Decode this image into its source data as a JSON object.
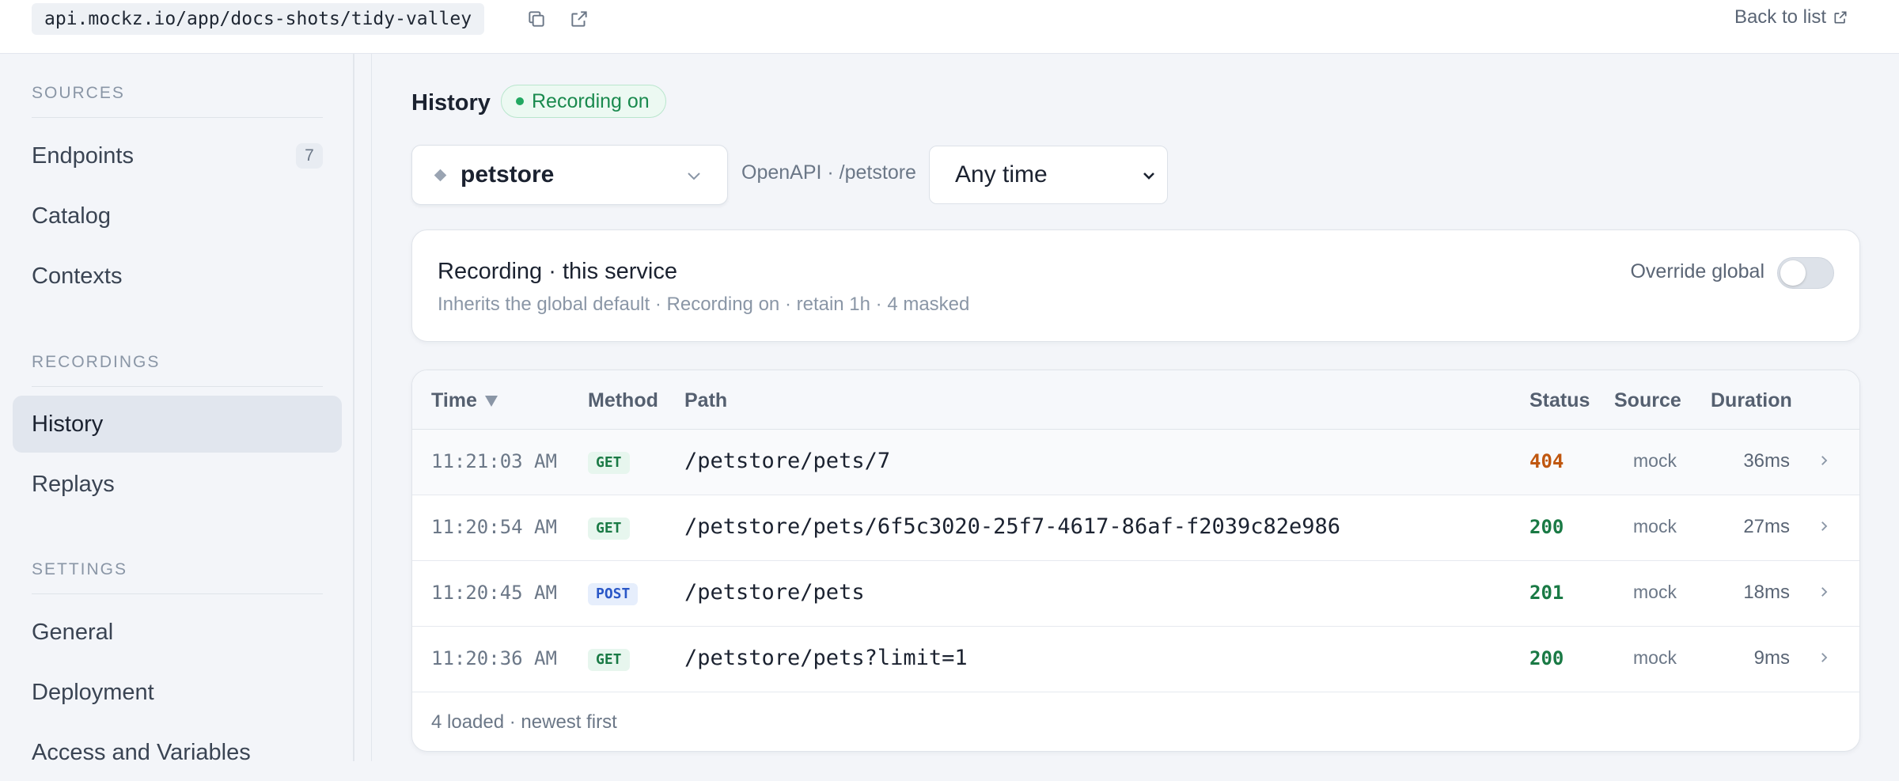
{
  "topbar": {
    "url": "api.mockz.io/app/docs-shots/tidy-valley",
    "copy_icon": "copy-icon",
    "open_icon": "external-link-icon",
    "back_label": "Back to list"
  },
  "sidebar": {
    "sections": [
      {
        "title": "SOURCES",
        "items": [
          {
            "label": "Endpoints",
            "count": "7"
          },
          {
            "label": "Catalog"
          },
          {
            "label": "Contexts"
          }
        ]
      },
      {
        "title": "RECORDINGS",
        "items": [
          {
            "label": "History",
            "active": true
          },
          {
            "label": "Replays"
          }
        ]
      },
      {
        "title": "SETTINGS",
        "items": [
          {
            "label": "General"
          },
          {
            "label": "Deployment"
          },
          {
            "label": "Access and Variables"
          }
        ]
      }
    ]
  },
  "main": {
    "title": "History",
    "recording_badge": "Recording on",
    "service": {
      "name": "petstore",
      "spec": "OpenAPI · /petstore"
    },
    "time_filter": "Any time",
    "recording_card": {
      "title": "Recording · this service",
      "subtitle": "Inherits the global default · Recording on · retain 1h · 4 masked",
      "override_label": "Override global",
      "override_on": false
    },
    "table": {
      "headers": {
        "time": "Time",
        "method": "Method",
        "path": "Path",
        "status": "Status",
        "source": "Source",
        "duration": "Duration"
      },
      "rows": [
        {
          "time": "11:21:03 AM",
          "method": "GET",
          "path": "/petstore/pets/7",
          "status": "404",
          "source": "mock",
          "duration": "36ms"
        },
        {
          "time": "11:20:54 AM",
          "method": "GET",
          "path": "/petstore/pets/6f5c3020-25f7-4617-86af-f2039c82e986",
          "status": "200",
          "source": "mock",
          "duration": "27ms"
        },
        {
          "time": "11:20:45 AM",
          "method": "POST",
          "path": "/petstore/pets",
          "status": "201",
          "source": "mock",
          "duration": "18ms"
        },
        {
          "time": "11:20:36 AM",
          "method": "GET",
          "path": "/petstore/pets?limit=1",
          "status": "200",
          "source": "mock",
          "duration": "9ms"
        }
      ],
      "footer": "4 loaded · newest first"
    }
  },
  "colors": {
    "accent_green": "#1a8a4e",
    "error_orange": "#c0570f",
    "post_blue": "#2a57c7"
  }
}
